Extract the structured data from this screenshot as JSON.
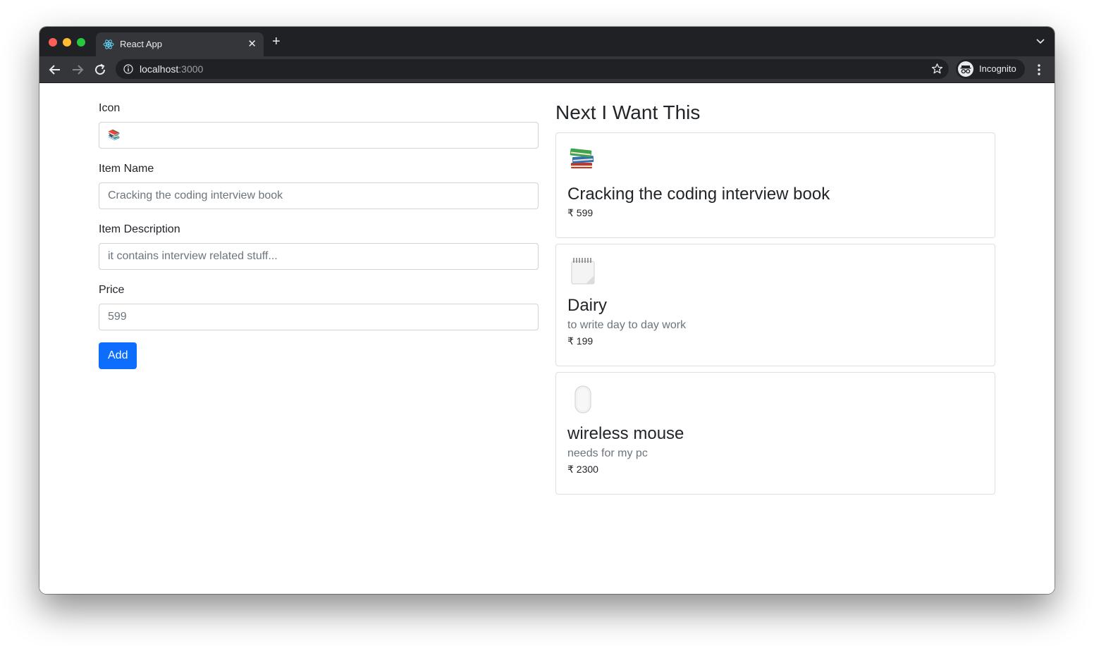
{
  "browser": {
    "tab_title": "React App",
    "url_host": "localhost",
    "url_port": ":3000",
    "profile_label": "Incognito"
  },
  "form": {
    "icon_label": "Icon",
    "icon_value": "📚",
    "name_label": "Item Name",
    "name_placeholder": "Cracking the coding interview book",
    "desc_label": "Item Description",
    "desc_placeholder": "it contains interview related stuff...",
    "price_label": "Price",
    "price_placeholder": "599",
    "add_label": "Add"
  },
  "list": {
    "title": "Next I Want This",
    "items": [
      {
        "icon": "books-icon",
        "name": "Cracking the coding interview book",
        "description": "",
        "price": "₹ 599"
      },
      {
        "icon": "notepad-icon",
        "name": "Dairy",
        "description": "to write day to day work",
        "price": "₹ 199"
      },
      {
        "icon": "mouse-icon",
        "name": "wireless mouse",
        "description": "needs for my pc",
        "price": "₹ 2300"
      }
    ]
  },
  "colors": {
    "primary": "#0d6efd",
    "chrome_dark": "#202124",
    "chrome_tab": "#35363a"
  }
}
